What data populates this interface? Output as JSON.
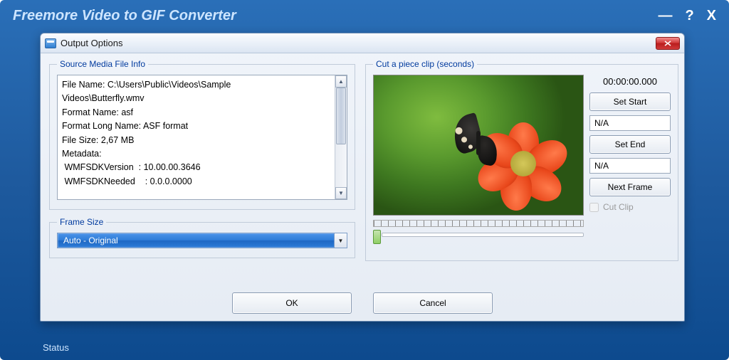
{
  "mainWindow": {
    "title": "Freemore Video to GIF Converter",
    "minimize": "—",
    "help": "?",
    "close": "X",
    "status": "Status"
  },
  "dialog": {
    "title": "Output Options",
    "sourceGroup": "Source Media File Info",
    "sourceInfo": "File Name: C:\\Users\\Public\\Videos\\Sample\nVideos\\Butterfly.wmv\nFormat Name: asf\nFormat Long Name: ASF format\nFile Size: 2,67 MB\nMetadata:\n WMFSDKVersion  : 10.00.00.3646\n WMFSDKNeeded    : 0.0.0.0000",
    "frameGroup": "Frame Size",
    "frameValue": "Auto - Original",
    "cutGroup": "Cut a piece clip (seconds)",
    "timecode": "00:00:00.000",
    "setStart": "Set Start",
    "startValue": "N/A",
    "setEnd": "Set End",
    "endValue": "N/A",
    "nextFrame": "Next Frame",
    "cutClip": "Cut Clip",
    "ok": "OK",
    "cancel": "Cancel"
  }
}
